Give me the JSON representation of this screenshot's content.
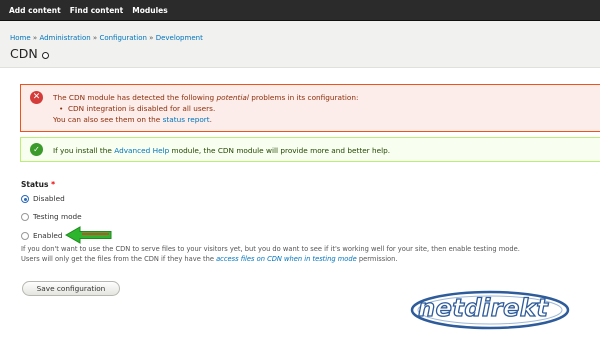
{
  "toolbar": {
    "items": [
      "Add content",
      "Find content",
      "Modules"
    ]
  },
  "breadcrumb": {
    "items": [
      "Home",
      "Administration",
      "Configuration",
      "Development"
    ],
    "separator": "»"
  },
  "page": {
    "title": "CDN"
  },
  "error_message": {
    "line1_prefix": "The CDN module has detected the following ",
    "line1_emphasis": "potential",
    "line1_suffix": " problems in its configuration:",
    "bullet": "CDN integration is disabled for all users.",
    "line3_prefix": "You can also see them on the ",
    "line3_link": "status report",
    "line3_suffix": "."
  },
  "status_message": {
    "prefix": "If you install the ",
    "link": "Advanced Help",
    "suffix": " module, the CDN module will provide more and better help."
  },
  "form": {
    "status_label": "Status",
    "required_mark": "*",
    "options": [
      {
        "label": "Disabled",
        "checked": true
      },
      {
        "label": "Testing mode",
        "checked": false
      },
      {
        "label": "Enabled",
        "checked": false
      }
    ],
    "description_line1": "If you don't want to use the CDN to serve files to your visitors yet, but you do want to see if it's working well for your site, then enable testing mode.",
    "description_line2_prefix": "Users will only get the files from the CDN if they have the ",
    "description_line2_link": "access files on CDN when in testing mode",
    "description_line2_suffix": " permission.",
    "save_label": "Save configuration"
  },
  "watermark": {
    "text": "netdirekt"
  },
  "colors": {
    "toolbar_bg": "#2b2b2b",
    "link": "#0074bd",
    "error_border": "#ed541d",
    "status_border": "#bbee77",
    "arrow": "#2db52d"
  }
}
